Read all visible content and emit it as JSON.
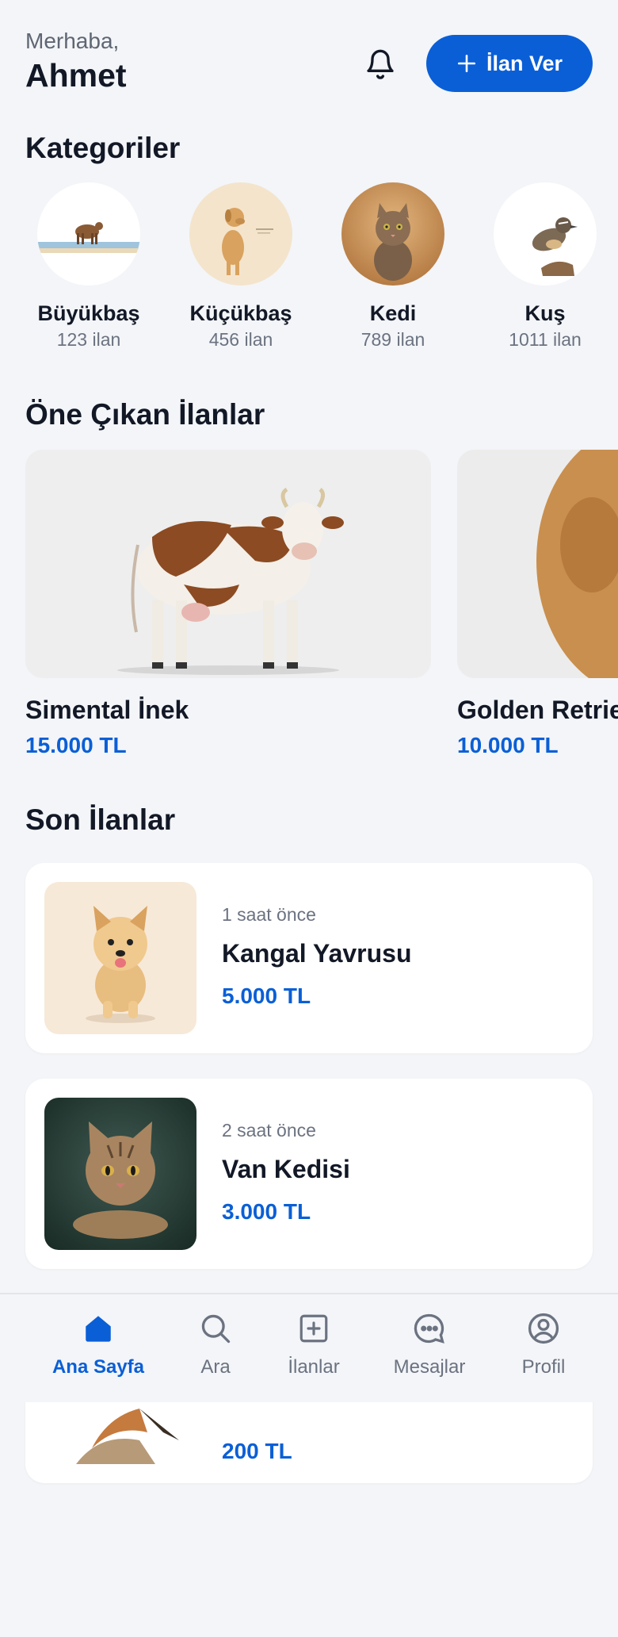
{
  "header": {
    "greeting": "Merhaba,",
    "user_name": "Ahmet",
    "post_button_label": "İlan Ver"
  },
  "sections": {
    "categories_title": "Kategoriler",
    "featured_title": "Öne Çıkan İlanlar",
    "recent_title": "Son İlanlar"
  },
  "categories": [
    {
      "name": "Büyükbaş",
      "count": "123 ilan",
      "icon": "cow-photo"
    },
    {
      "name": "Küçükbaş",
      "count": "456 ilan",
      "icon": "dog-photo"
    },
    {
      "name": "Kedi",
      "count": "789 ilan",
      "icon": "cat-photo"
    },
    {
      "name": "Kuş",
      "count": "1011 ilan",
      "icon": "bird-photo"
    }
  ],
  "featured": [
    {
      "name": "Simental İnek",
      "price": "15.000 TL",
      "image": "cow-image"
    },
    {
      "name": "Golden Retriever",
      "price": "10.000 TL",
      "image": "golden-retriever-image"
    }
  ],
  "recent": [
    {
      "time": "1 saat önce",
      "title": "Kangal Yavrusu",
      "price": "5.000 TL",
      "image": "puppy-image"
    },
    {
      "time": "2 saat önce",
      "title": "Van Kedisi",
      "price": "3.000 TL",
      "image": "tabby-cat-image"
    },
    {
      "price": "200 TL",
      "image": "bird-image"
    }
  ],
  "nav": [
    {
      "label": "Ana Sayfa",
      "icon": "home-icon",
      "active": true
    },
    {
      "label": "Ara",
      "icon": "search-icon",
      "active": false
    },
    {
      "label": "İlanlar",
      "icon": "plus-square-icon",
      "active": false
    },
    {
      "label": "Mesajlar",
      "icon": "chat-icon",
      "active": false
    },
    {
      "label": "Profil",
      "icon": "user-circle-icon",
      "active": false
    }
  ],
  "colors": {
    "accent": "#0a5fd6",
    "background": "#f3f5f8",
    "text": "#121826"
  }
}
